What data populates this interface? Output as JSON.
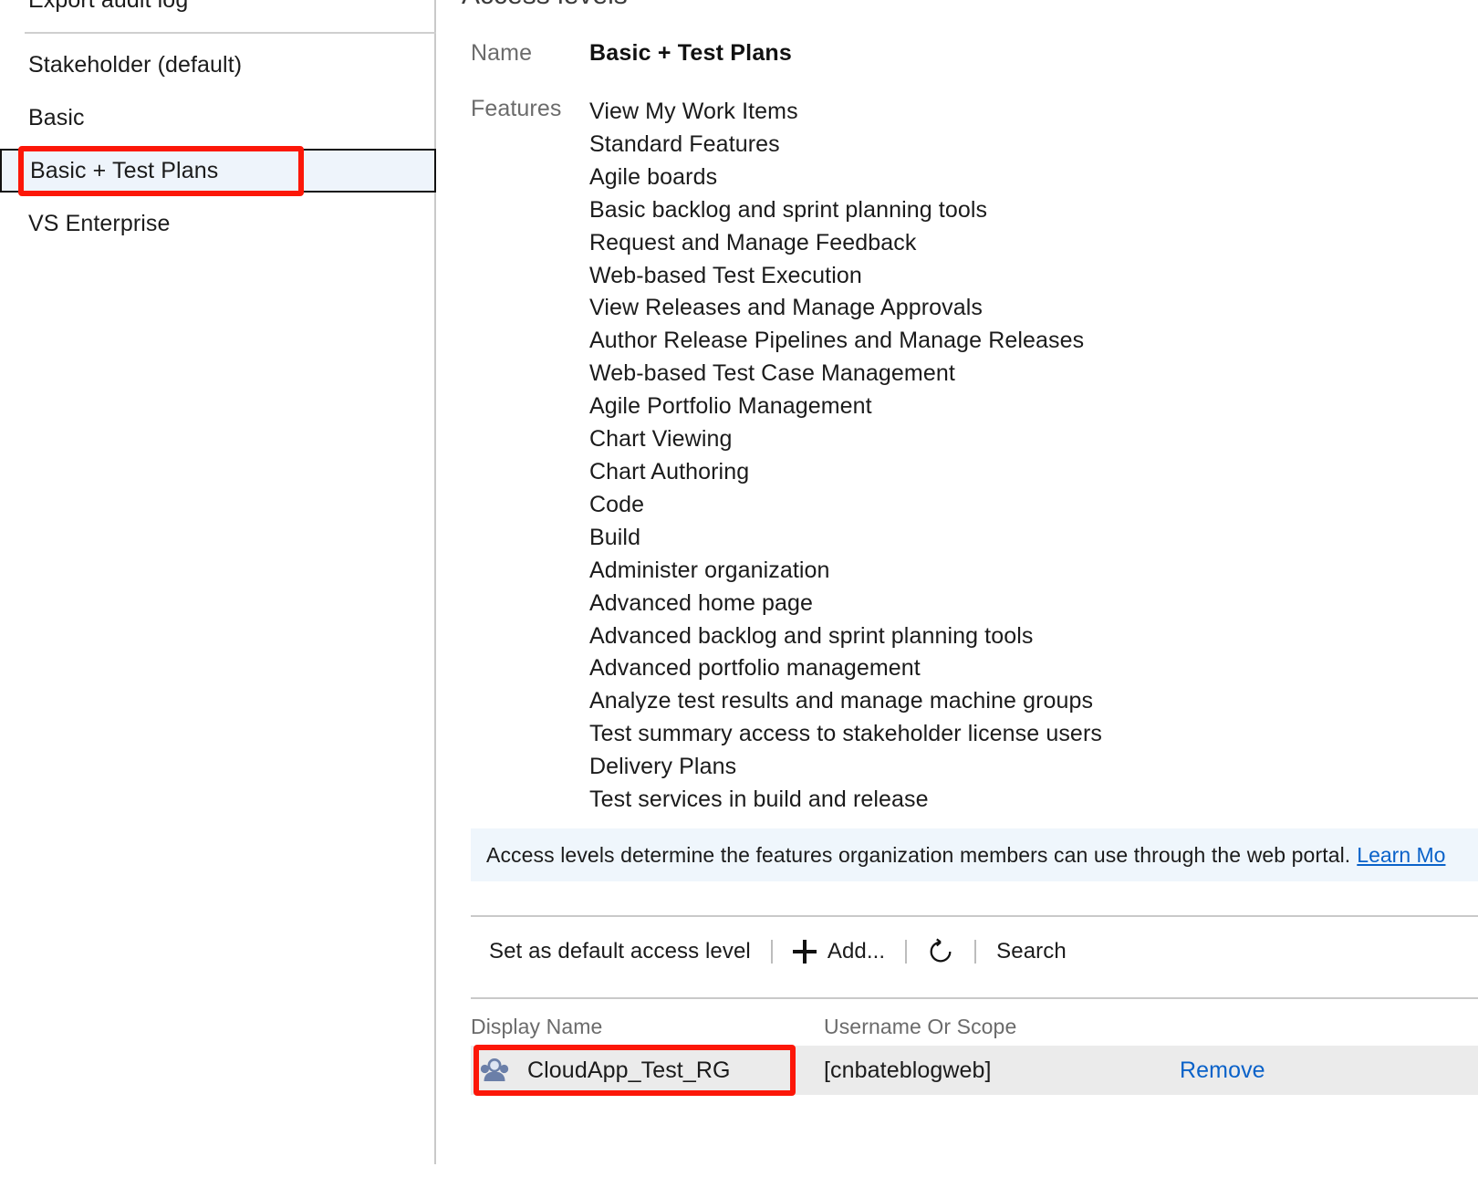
{
  "left_panel": {
    "export_audit_log": "Export audit log",
    "access_levels": [
      {
        "label": "Stakeholder (default)",
        "selected": false
      },
      {
        "label": "Basic",
        "selected": false
      },
      {
        "label": "Basic + Test Plans",
        "selected": true
      },
      {
        "label": "VS Enterprise",
        "selected": false
      }
    ]
  },
  "right_panel": {
    "title": "Access levels",
    "detail": {
      "name_label": "Name",
      "name_value": "Basic + Test Plans",
      "features_label": "Features",
      "features": [
        "View My Work Items",
        "Standard Features",
        "Agile boards",
        "Basic backlog and sprint planning tools",
        "Request and Manage Feedback",
        "Web-based Test Execution",
        "View Releases and Manage Approvals",
        "Author Release Pipelines and Manage Releases",
        "Web-based Test Case Management",
        "Agile Portfolio Management",
        "Chart Viewing",
        "Chart Authoring",
        "Code",
        "Build",
        "Administer organization",
        "Advanced home page",
        "Advanced backlog and sprint planning tools",
        "Advanced portfolio management",
        "Analyze test results and manage machine groups",
        "Test summary access to stakeholder license users",
        "Delivery Plans",
        "Test services in build and release"
      ]
    },
    "info_banner": {
      "text": "Access levels determine the features organization members can use through the web portal.",
      "link_label": "Learn Mo"
    },
    "toolbar": {
      "set_default_label": "Set as default access level",
      "add_label": "Add...",
      "refresh_icon": "refresh-icon",
      "search_label": "Search"
    },
    "table": {
      "columns": [
        "Display Name",
        "Username Or Scope",
        ""
      ],
      "rows": [
        {
          "avatar": "group-avatar-icon",
          "display_name": "CloudApp_Test_RG",
          "username_or_scope": "[cnbateblogweb]",
          "action": "Remove"
        }
      ]
    }
  },
  "annotations": {
    "highlight_color": "#fc1708",
    "selected_item_highlight": "Basic + Test Plans",
    "row_highlight": "CloudApp_Test_RG"
  }
}
